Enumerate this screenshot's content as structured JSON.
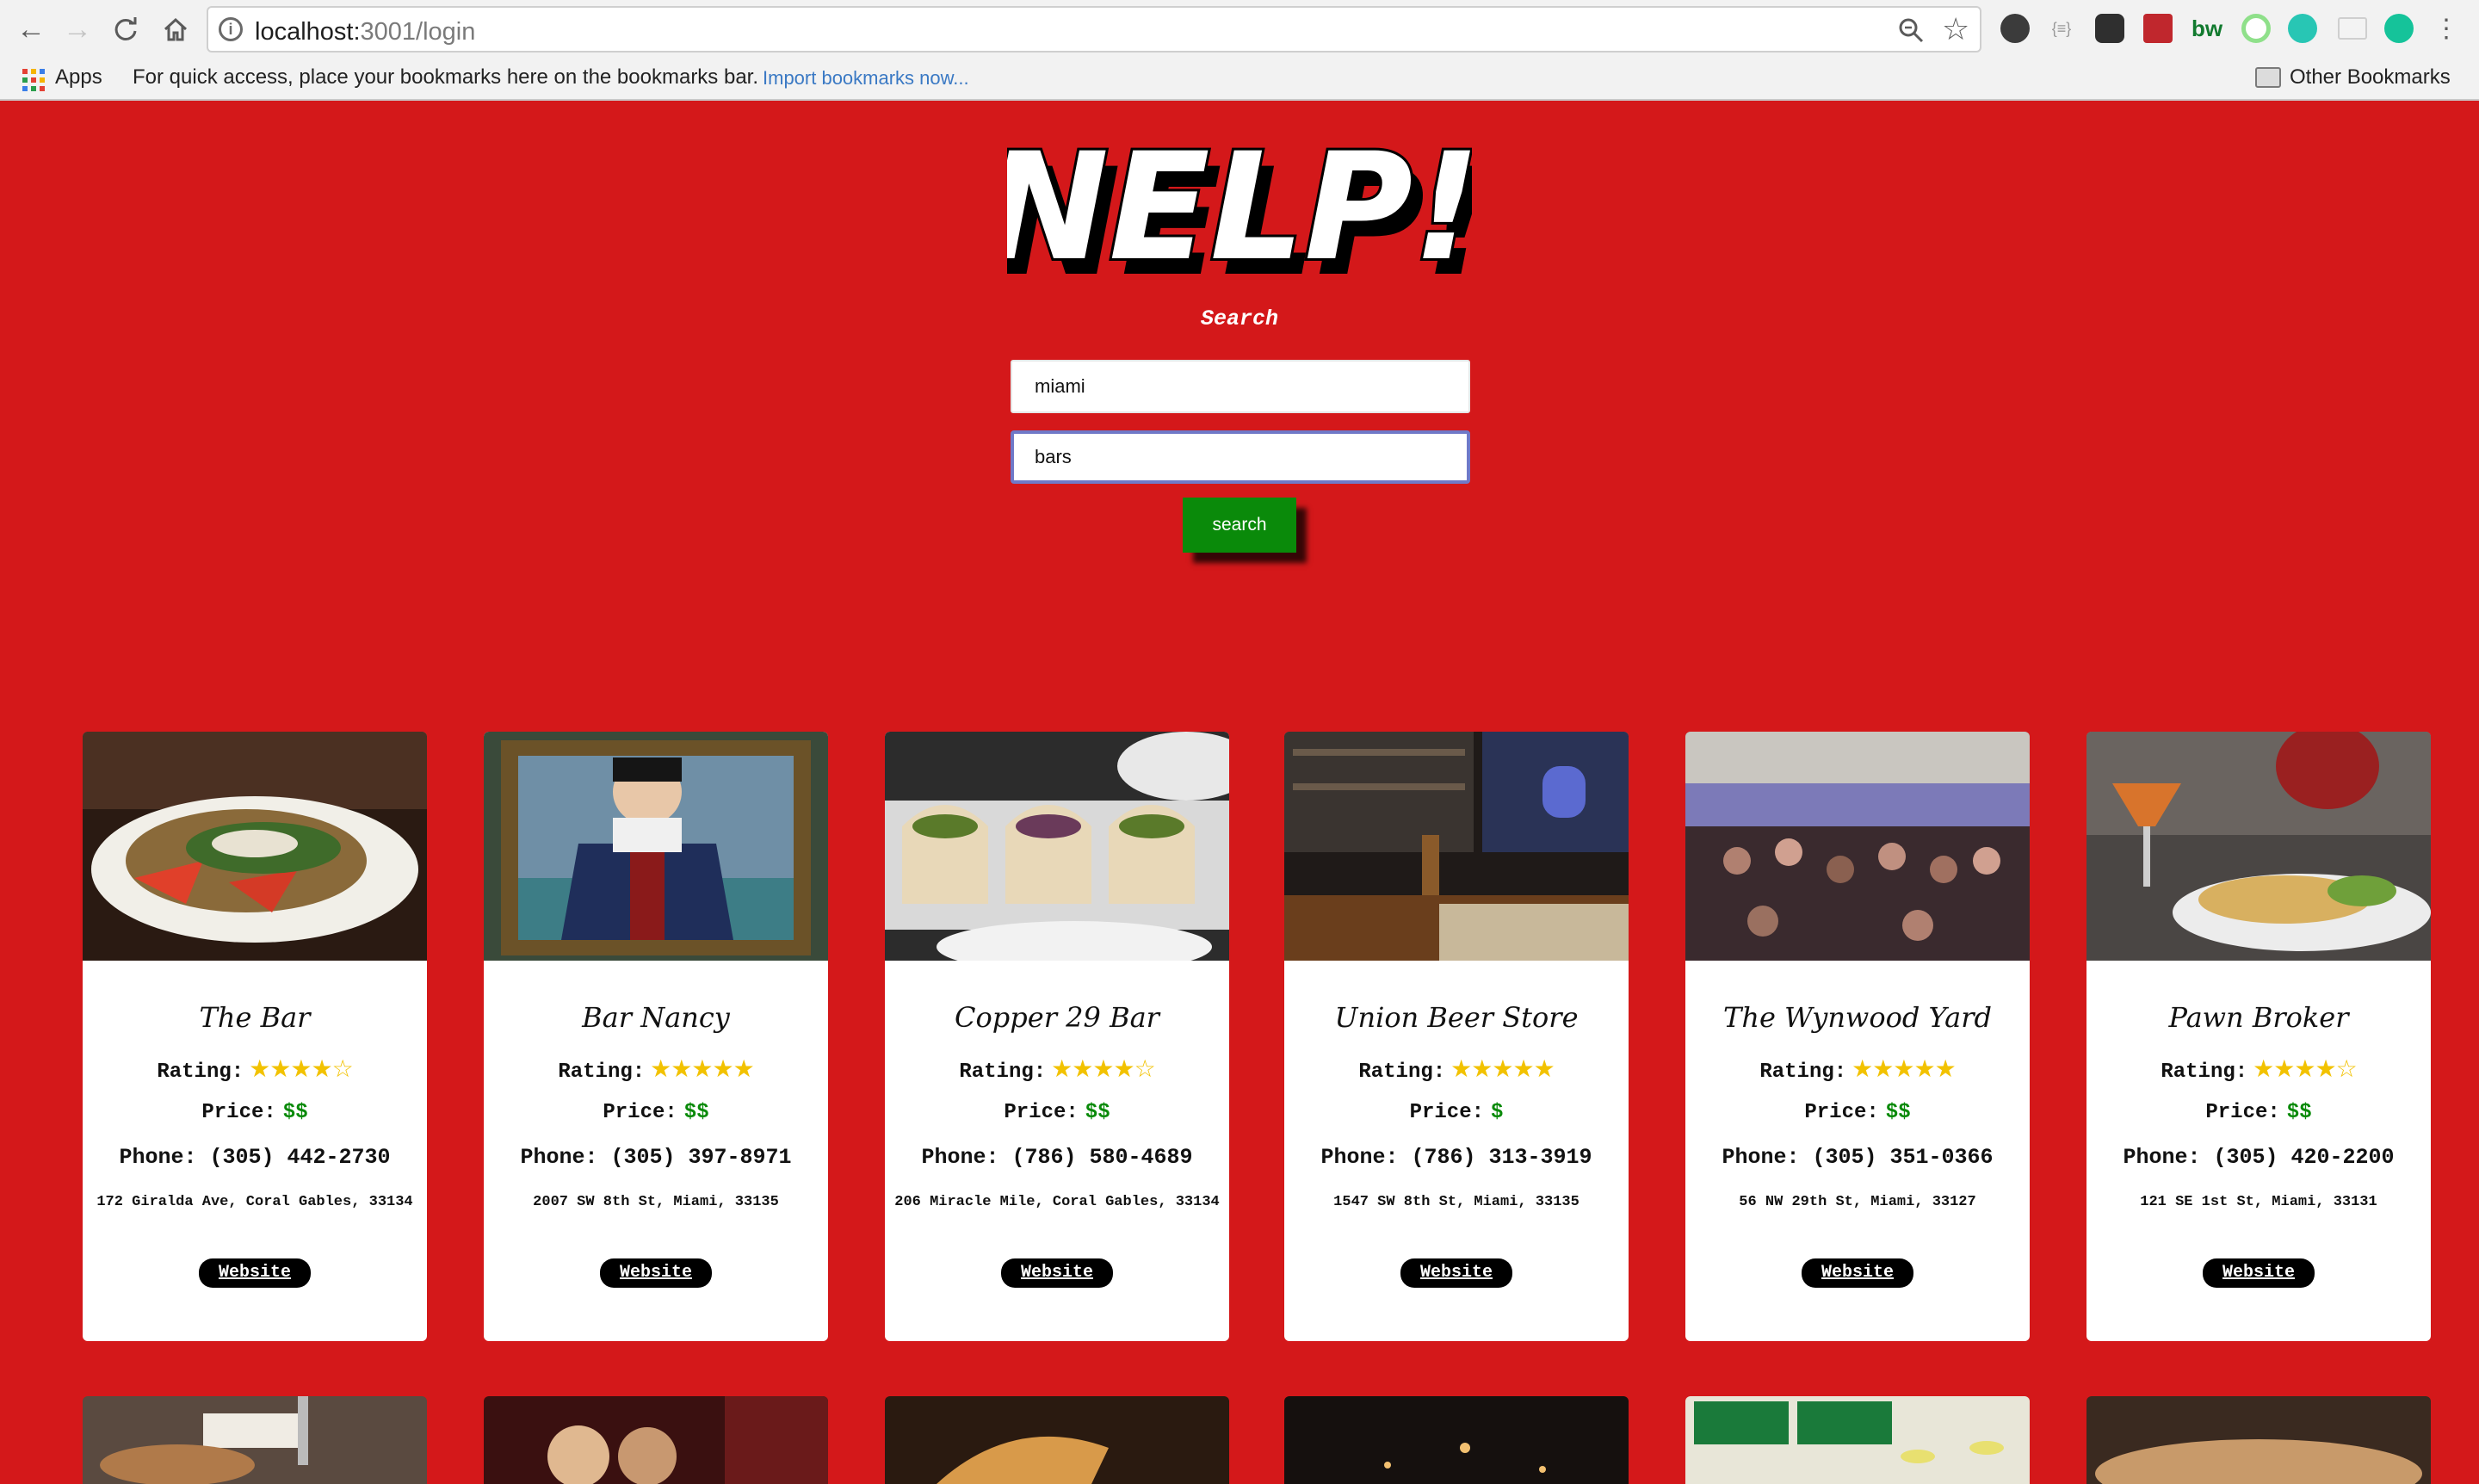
{
  "browser": {
    "url_host": "localhost:",
    "url_rest": "3001/login",
    "bookmarks_apps": "Apps",
    "bookmarks_hint": "For quick access, place your bookmarks here on the bookmarks bar.",
    "bookmarks_import": "Import bookmarks now...",
    "bookmarks_other": "Other Bookmarks"
  },
  "app": {
    "logo_text": "NELP!",
    "search_heading": "Search",
    "location_value": "miami",
    "term_value": "bars",
    "search_button": "search"
  },
  "labels": {
    "rating": "Rating:",
    "price": "Price:",
    "phone": "Phone:",
    "website": "Website"
  },
  "businesses": [
    {
      "name": "The Bar",
      "stars": "★★★★☆",
      "price": "$$",
      "phone": "(305) 442-2730",
      "address": "172 Giralda Ave, Coral Gables, 33134"
    },
    {
      "name": "Bar Nancy",
      "stars": "★★★★★",
      "price": "$$",
      "phone": "(305) 397-8971",
      "address": "2007 SW 8th St, Miami, 33135"
    },
    {
      "name": "Copper 29 Bar",
      "stars": "★★★★☆",
      "price": "$$",
      "phone": "(786) 580-4689",
      "address": "206 Miracle Mile, Coral Gables, 33134"
    },
    {
      "name": "Union Beer Store",
      "stars": "★★★★★",
      "price": "$",
      "phone": "(786) 313-3919",
      "address": "1547 SW 8th St, Miami, 33135"
    },
    {
      "name": "The Wynwood Yard",
      "stars": "★★★★★",
      "price": "$$",
      "phone": "(305) 351-0366",
      "address": "56 NW 29th St, Miami, 33127"
    },
    {
      "name": "Pawn Broker",
      "stars": "★★★★☆",
      "price": "$$",
      "phone": "(305) 420-2200",
      "address": "121 SE 1st St, Miami, 33131"
    }
  ],
  "colors": {
    "page_background": "#d4181a",
    "search_button": "#0a8a0a",
    "star": "#f2c200",
    "price": "#0a8a0a"
  }
}
